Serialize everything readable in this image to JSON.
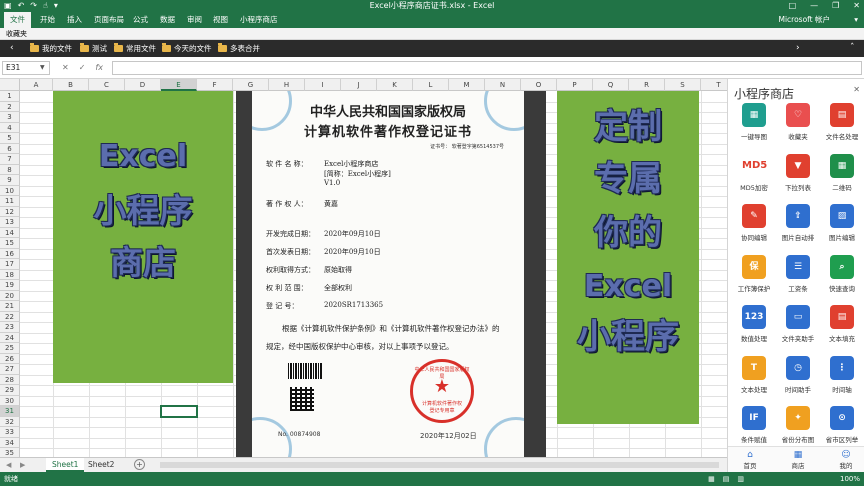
{
  "titlebar": {
    "title": "Excel小程序商店证书.xlsx - Excel",
    "qa_icons": [
      "save-icon",
      "undo-icon",
      "redo-icon",
      "touch-mode-icon",
      "customize-icon"
    ],
    "win_buttons": [
      "□",
      "—",
      "❐",
      "✕"
    ]
  },
  "ribbon": {
    "tabs": [
      "文件",
      "开始",
      "插入",
      "页面布局",
      "公式",
      "数据",
      "审阅",
      "视图",
      "小程序商店"
    ],
    "account": "Microsoft 帐户",
    "account_arrow": "▾"
  },
  "favorites": {
    "header": "收藏夹",
    "items": [
      "我的文件",
      "测试",
      "常用文件",
      "今天的文件",
      "多表合并"
    ]
  },
  "formula": {
    "namebox": "E31",
    "cancel": "✕",
    "enter": "✓",
    "fx": "fx",
    "value": ""
  },
  "grid": {
    "columns": [
      "A",
      "B",
      "C",
      "D",
      "E",
      "F",
      "G",
      "H",
      "I",
      "J",
      "K",
      "L",
      "M",
      "N",
      "O",
      "P",
      "Q",
      "R",
      "S",
      "T"
    ],
    "rows": [
      "1",
      "2",
      "3",
      "4",
      "5",
      "6",
      "7",
      "8",
      "9",
      "10",
      "11",
      "12",
      "13",
      "14",
      "15",
      "16",
      "17",
      "18",
      "19",
      "20",
      "21",
      "22",
      "23",
      "24",
      "25",
      "26",
      "27",
      "28",
      "29",
      "30",
      "31",
      "32",
      "33",
      "34",
      "35"
    ],
    "selected_col": "E",
    "selected_row": "31"
  },
  "left_banner": {
    "line1": "Excel",
    "line2": "小程序",
    "line3": "商店"
  },
  "right_banner": {
    "line1": "定制",
    "line2": "专属",
    "line3": "你的",
    "line4": "Excel",
    "line5": "小程序"
  },
  "certificate": {
    "title1": "中华人民共和国国家版权局",
    "title2": "计算机软件著作权登记证书",
    "cert_no": "证书号： 软著登字第6514537号",
    "software_name_label": "软 件 名 称：",
    "software_name": "Excel小程序商店",
    "short_name": "[简称：Excel小程序]",
    "version": "V1.0",
    "owner_label": "著 作 权 人：",
    "owner": "黄嘉",
    "dev_date_label": "开发完成日期：",
    "dev_date": "2020年09月10日",
    "pub_date_label": "首次发表日期：",
    "pub_date": "2020年09月10日",
    "method_label": "权利取得方式：",
    "method": "原始取得",
    "scope_label": "权  利  范  围：",
    "scope": "全部权利",
    "reg_label": "登     记     号：",
    "reg_no": "2020SR1713365",
    "para1": "根据《计算机软件保护条例》和《计算机软件著作权登记办法》的",
    "para2": "规定，经中国版权保护中心审核，对以上事项予以登记。",
    "seal_top": "中华人民共和国国家版权局",
    "seal_l1": "计算机软件著作权",
    "seal_l2": "登记专用章",
    "number": "No. 00874908",
    "issue_date": "2020年12月02日"
  },
  "sheets": {
    "tabs": [
      "Sheet1",
      "Sheet2"
    ],
    "active": "Sheet1",
    "nav_prev": "◀",
    "nav_next": "▶",
    "add": "+"
  },
  "status": {
    "ready": "就绪",
    "zoom": "100%"
  },
  "panel": {
    "title": "小程序商店",
    "close": "✕",
    "tiles": [
      {
        "label": "一键导图",
        "icon": "image-export-icon",
        "color": "#1f9e8f",
        "glyph": "▦"
      },
      {
        "label": "收藏夹",
        "icon": "favorites-icon",
        "color": "#e94f4f",
        "glyph": "♡"
      },
      {
        "label": "文件名处理",
        "icon": "rename-icon",
        "color": "#e0402f",
        "glyph": "▤"
      },
      {
        "label": "MD5加密",
        "icon": "md5-icon",
        "color": "#ffffff",
        "glyph": "MD5"
      },
      {
        "label": "下拉列表",
        "icon": "dropdown-icon",
        "color": "#e0402f",
        "glyph": "▼"
      },
      {
        "label": "二维码",
        "icon": "qrcode-icon",
        "color": "#1f8f4a",
        "glyph": "▦"
      },
      {
        "label": "协同编辑",
        "icon": "co-edit-icon",
        "color": "#e0402f",
        "glyph": "✎"
      },
      {
        "label": "图片自动排",
        "icon": "image-layout-icon",
        "color": "#2f6fcf",
        "glyph": "⇪"
      },
      {
        "label": "图片编辑",
        "icon": "image-edit-icon",
        "color": "#2f6fcf",
        "glyph": "▨"
      },
      {
        "label": "工作簿保护",
        "icon": "protect-icon",
        "color": "#f0a020",
        "glyph": "保"
      },
      {
        "label": "工资条",
        "icon": "payslip-icon",
        "color": "#2f6fcf",
        "glyph": "☰"
      },
      {
        "label": "快速查询",
        "icon": "search-icon",
        "color": "#1f9e4f",
        "glyph": "⌕"
      },
      {
        "label": "数值处理",
        "icon": "number-icon",
        "color": "#2f6fcf",
        "glyph": "123"
      },
      {
        "label": "文件夹助手",
        "icon": "folder-icon",
        "color": "#2f6fcf",
        "glyph": "▭"
      },
      {
        "label": "文本填充",
        "icon": "text-fill-icon",
        "color": "#e0402f",
        "glyph": "▤"
      },
      {
        "label": "文本处理",
        "icon": "text-icon",
        "color": "#f0a020",
        "glyph": "T"
      },
      {
        "label": "时间助手",
        "icon": "clock-icon",
        "color": "#2f6fcf",
        "glyph": "◷"
      },
      {
        "label": "时间轴",
        "icon": "timeline-icon",
        "color": "#2f6fcf",
        "glyph": "⋮"
      },
      {
        "label": "条件赋值",
        "icon": "condition-icon",
        "color": "#2f6fcf",
        "glyph": "IF"
      },
      {
        "label": "省份分布图",
        "icon": "province-map-icon",
        "color": "#f0a020",
        "glyph": "✦"
      },
      {
        "label": "省市区列举",
        "icon": "location-icon",
        "color": "#2f6fcf",
        "glyph": "⊙"
      }
    ],
    "nav": [
      {
        "label": "首页",
        "icon": "home-icon",
        "glyph": "⌂"
      },
      {
        "label": "商店",
        "icon": "store-icon",
        "glyph": "▦"
      },
      {
        "label": "我的",
        "icon": "user-icon",
        "glyph": "☺"
      }
    ]
  }
}
